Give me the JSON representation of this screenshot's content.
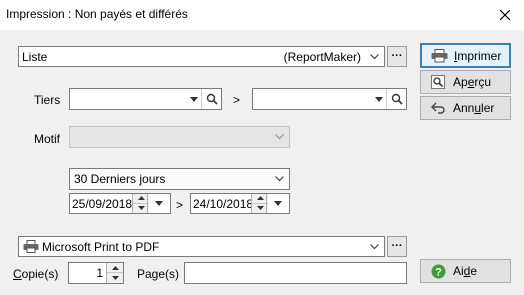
{
  "window": {
    "title": "Impression : Non payés et différés"
  },
  "report": {
    "value": "Liste",
    "engine": "(ReportMaker)"
  },
  "tiers": {
    "label": "Tiers",
    "separator": ">"
  },
  "motif": {
    "label_pre": "Motif",
    "label_char": "",
    "value": ""
  },
  "period": {
    "value": "30 Derniers jours",
    "date_from": "25/09/2018",
    "date_to": "24/10/2018",
    "separator": ">"
  },
  "printer": {
    "value": "Microsoft Print to PDF"
  },
  "copies": {
    "label_char": "C",
    "label_rest": "opie(s)",
    "value": "1"
  },
  "pages": {
    "label": "Page(s)",
    "value": ""
  },
  "buttons": {
    "print": {
      "pre": "",
      "char": "I",
      "post": "mprimer"
    },
    "preview": {
      "pre": "Ap",
      "char": "e",
      "post": "rçu"
    },
    "cancel": {
      "pre": "Ann",
      "char": "u",
      "post": "ler"
    },
    "help": {
      "pre": "Ai",
      "char": "d",
      "post": "e"
    }
  },
  "colors": {
    "accent": "#3c7fb1",
    "help_icon": "#3f9b3a",
    "disabled_field": "#e5e5e5"
  }
}
